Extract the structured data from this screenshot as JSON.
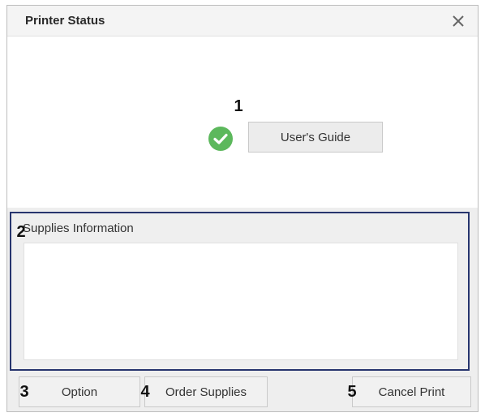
{
  "window": {
    "title": "Printer Status"
  },
  "callouts": [
    "1",
    "2",
    "3",
    "4",
    "5"
  ],
  "status": {
    "users_guide_label": "User's Guide",
    "ok_color": "#5cb85c"
  },
  "supplies": {
    "label": "Supplies Information",
    "border_color": "#27356e"
  },
  "buttons": {
    "option_label": "Option",
    "order_supplies_label": "Order Supplies",
    "cancel_print_label": "Cancel Print"
  }
}
